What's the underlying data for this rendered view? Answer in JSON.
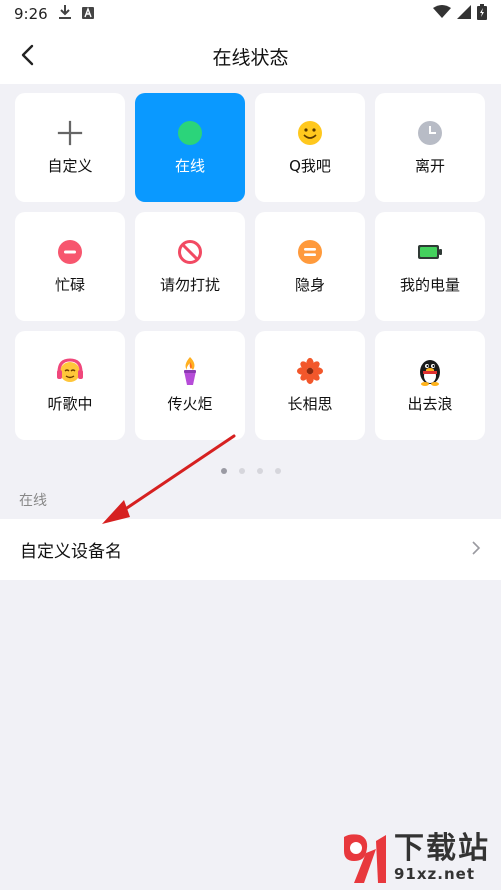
{
  "status_bar": {
    "time": "9:26",
    "icons": [
      "download-icon",
      "a-icon",
      "wifi-icon",
      "signal-icon",
      "battery-icon"
    ]
  },
  "header": {
    "title": "在线状态",
    "back_icon": "back-arrow-icon"
  },
  "status_options": [
    {
      "label": "自定义",
      "icon": "plus-icon",
      "selected": false
    },
    {
      "label": "在线",
      "icon": "green-dot-icon",
      "selected": true
    },
    {
      "label": "Q我吧",
      "icon": "smiley-icon",
      "selected": false
    },
    {
      "label": "离开",
      "icon": "clock-icon",
      "selected": false
    },
    {
      "label": "忙碌",
      "icon": "minus-circle-icon",
      "selected": false
    },
    {
      "label": "请勿打扰",
      "icon": "no-entry-icon",
      "selected": false
    },
    {
      "label": "隐身",
      "icon": "equals-circle-icon",
      "selected": false
    },
    {
      "label": "我的电量",
      "icon": "battery-level-icon",
      "selected": false
    },
    {
      "label": "听歌中",
      "icon": "headphones-face-icon",
      "selected": false
    },
    {
      "label": "传火炬",
      "icon": "torch-icon",
      "selected": false
    },
    {
      "label": "长相思",
      "icon": "flower-icon",
      "selected": false
    },
    {
      "label": "出去浪",
      "icon": "penguin-icon",
      "selected": false
    }
  ],
  "pagination": {
    "total": 4,
    "current": 1
  },
  "section": {
    "label": "在线"
  },
  "device_row": {
    "label": "自定义设备名",
    "chevron_icon": "chevron-right-icon"
  },
  "watermark": {
    "title": "下载站",
    "domain": "91xz.net"
  },
  "colors": {
    "accent": "#0a99ff",
    "background": "#f1f1f6",
    "arrow": "#d62020"
  }
}
